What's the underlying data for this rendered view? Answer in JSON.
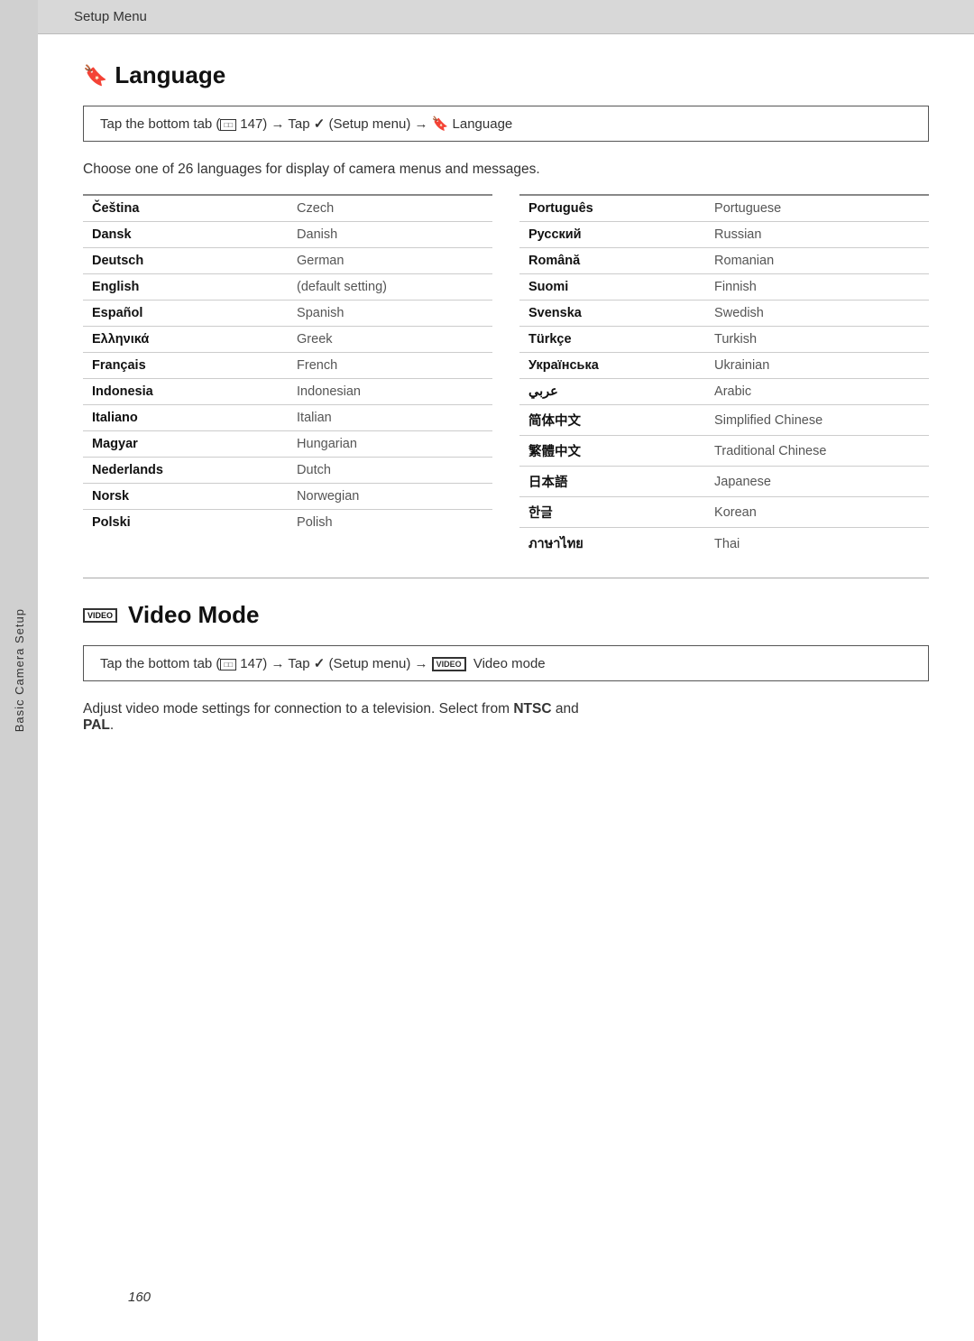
{
  "header": {
    "label": "Setup Menu"
  },
  "side_tab": {
    "label": "Basic Camera Setup"
  },
  "language_section": {
    "title": "Language",
    "nav_text": "Tap the bottom tab (□□ 147) → Tap ✓ (Setup menu) → 🖖 Language",
    "description": "Choose one of 26 languages for display of camera menus and messages.",
    "left_languages": [
      {
        "native": "Čeština",
        "english": "Czech"
      },
      {
        "native": "Dansk",
        "english": "Danish"
      },
      {
        "native": "Deutsch",
        "english": "German"
      },
      {
        "native": "English",
        "english": "(default setting)"
      },
      {
        "native": "Español",
        "english": "Spanish"
      },
      {
        "native": "Ελληνικά",
        "english": "Greek"
      },
      {
        "native": "Français",
        "english": "French"
      },
      {
        "native": "Indonesia",
        "english": "Indonesian"
      },
      {
        "native": "Italiano",
        "english": "Italian"
      },
      {
        "native": "Magyar",
        "english": "Hungarian"
      },
      {
        "native": "Nederlands",
        "english": "Dutch"
      },
      {
        "native": "Norsk",
        "english": "Norwegian"
      },
      {
        "native": "Polski",
        "english": "Polish"
      }
    ],
    "right_languages": [
      {
        "native": "Português",
        "english": "Portuguese"
      },
      {
        "native": "Русский",
        "english": "Russian"
      },
      {
        "native": "Română",
        "english": "Romanian"
      },
      {
        "native": "Suomi",
        "english": "Finnish"
      },
      {
        "native": "Svenska",
        "english": "Swedish"
      },
      {
        "native": "Türkçe",
        "english": "Turkish"
      },
      {
        "native": "Українська",
        "english": "Ukrainian"
      },
      {
        "native": "عربي",
        "english": "Arabic"
      },
      {
        "native": "简体中文",
        "english": "Simplified Chinese"
      },
      {
        "native": "繁體中文",
        "english": "Traditional Chinese"
      },
      {
        "native": "日本語",
        "english": "Japanese"
      },
      {
        "native": "한글",
        "english": "Korean"
      },
      {
        "native": "ภาษาไทย",
        "english": "Thai"
      }
    ]
  },
  "video_section": {
    "title": "Video Mode",
    "nav_text": "Tap the bottom tab (□□ 147) → Tap ✓ (Setup menu) → VIDEO Video mode",
    "description_start": "Adjust video mode settings for connection to a television. Select from ",
    "ntsc_label": "NTSC",
    "description_middle": " and ",
    "pal_label": "PAL",
    "description_end": "."
  },
  "page_number": "160"
}
